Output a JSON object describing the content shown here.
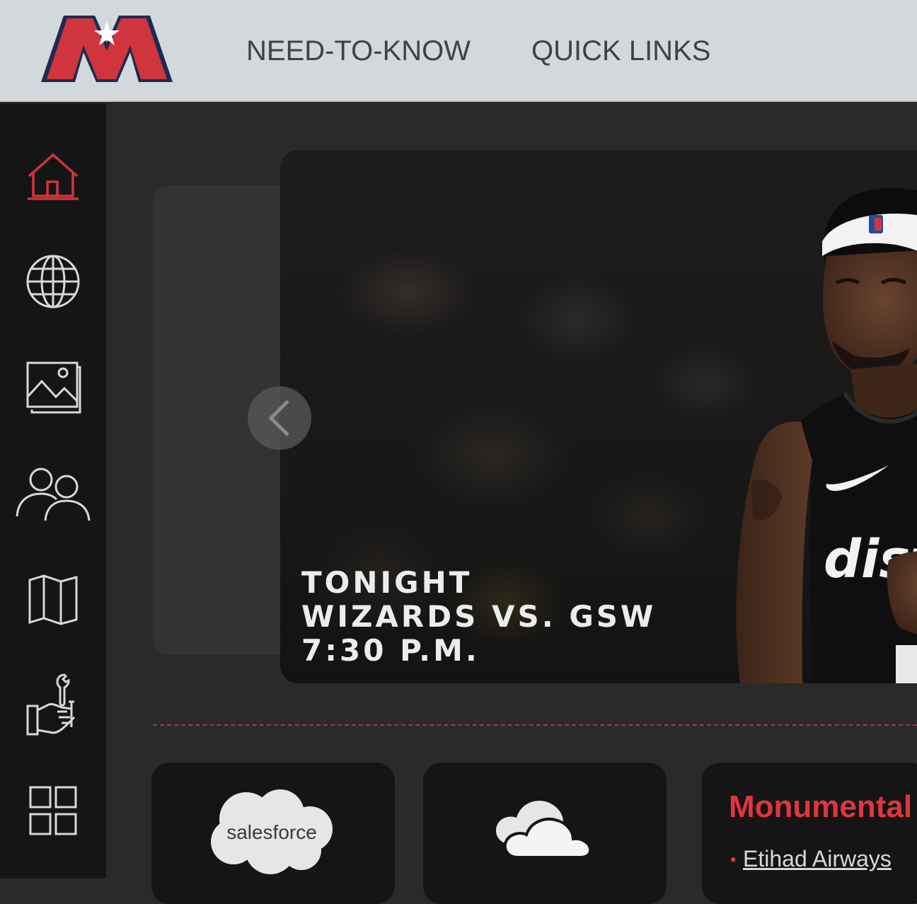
{
  "brand": {
    "accent": "#d0343c",
    "navy": "#1d2b53",
    "topbar_bg": "#d3d8dc",
    "sidebar_bg": "#151515"
  },
  "topnav": {
    "items": [
      "NEED-TO-KNOW",
      "QUICK LINKS"
    ]
  },
  "sidebar": {
    "items": [
      {
        "icon": "home-icon",
        "active": true
      },
      {
        "icon": "globe-icon",
        "active": false
      },
      {
        "icon": "image-gallery-icon",
        "active": false
      },
      {
        "icon": "people-icon",
        "active": false
      },
      {
        "icon": "map-icon",
        "active": false
      },
      {
        "icon": "tools-hand-icon",
        "active": false
      },
      {
        "icon": "grid-icon",
        "active": false
      }
    ]
  },
  "hero": {
    "line1": "TONIGHT",
    "line2": "WIZARDS VS. GSW",
    "line3": "7:30 P.M.",
    "jersey_text": "district"
  },
  "cards": {
    "salesforce_label": "salesforce",
    "monumental_title": "Monumental",
    "monumental_link": "Etihad Airways",
    "onedrive_icon": "cloud-icon"
  }
}
